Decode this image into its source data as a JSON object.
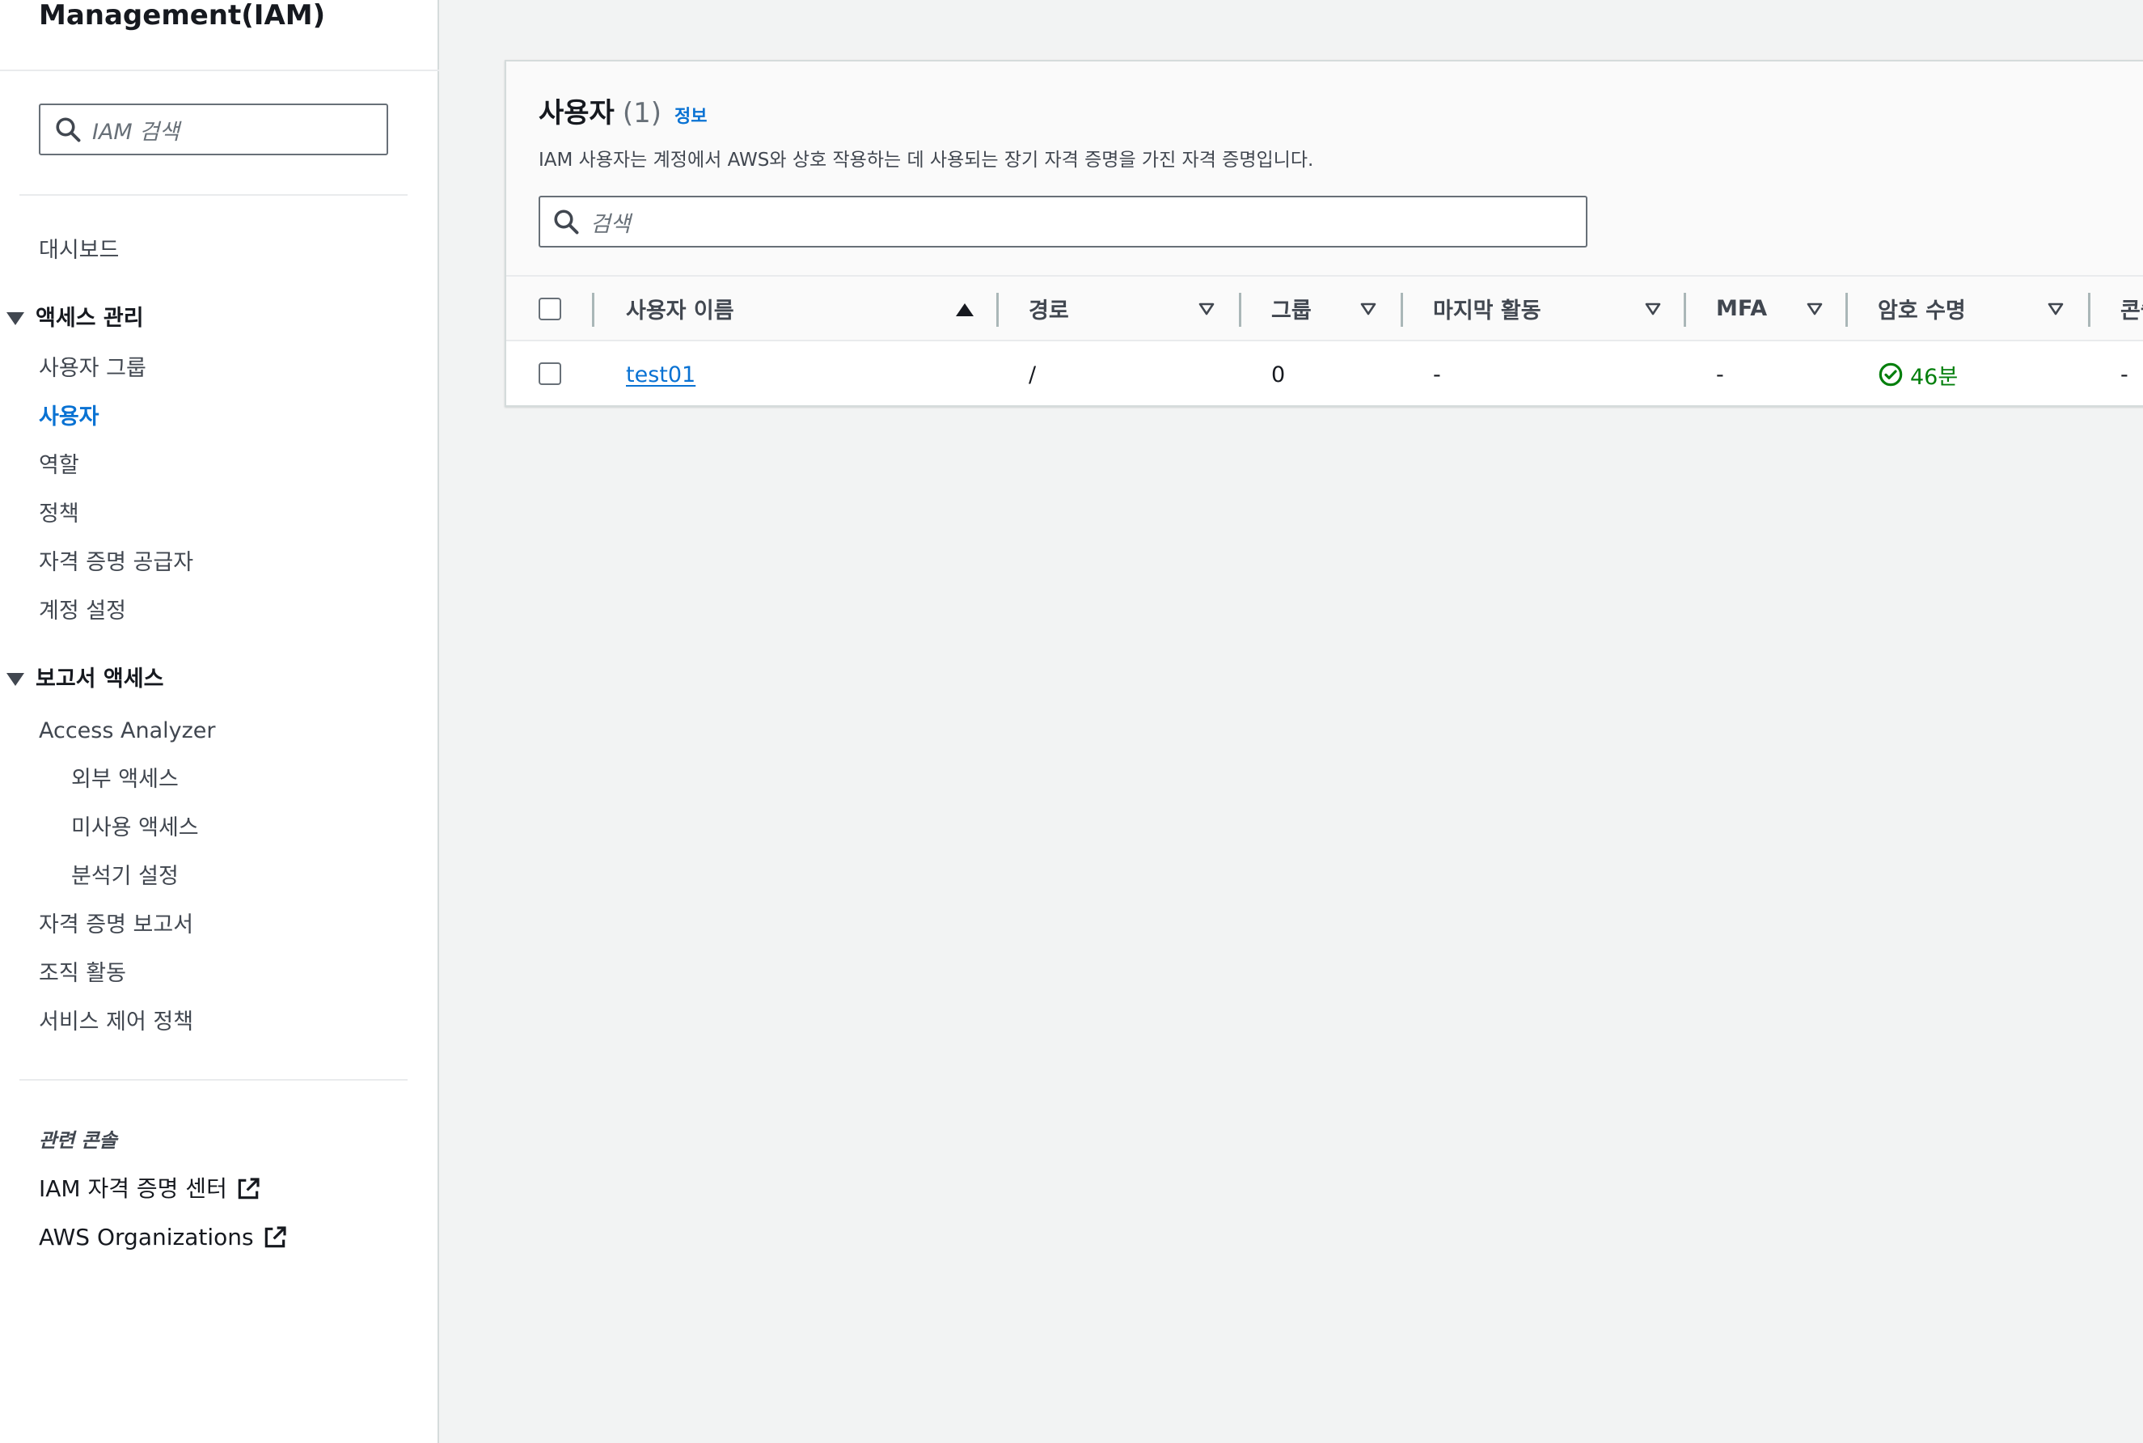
{
  "sidebar": {
    "app_title": "Management(IAM)",
    "search_placeholder": "IAM 검색",
    "dashboard": "대시보드",
    "access_mgmt": {
      "heading": "액세스 관리",
      "items": [
        "사용자 그룹",
        "사용자",
        "역할",
        "정책",
        "자격 증명 공급자",
        "계정 설정"
      ],
      "active": "사용자"
    },
    "report_access": {
      "heading": "보고서 액세스",
      "analyzer": "Access Analyzer",
      "analyzer_sub": [
        "외부 액세스",
        "미사용 액세스",
        "분석기 설정"
      ],
      "items": [
        "자격 증명 보고서",
        "조직 활동",
        "서비스 제어 정책"
      ]
    },
    "related_consoles": {
      "heading": "관련 콘솔",
      "links": [
        "IAM 자격 증명 센터",
        "AWS Organizations"
      ]
    }
  },
  "main": {
    "title": "사용자",
    "count": "(1)",
    "info_link": "정보",
    "description": "IAM 사용자는 계정에서 AWS와 상호 작용하는 데 사용되는 장기 자격 증명을 가진 자격 증명입니다.",
    "search_placeholder": "검색",
    "columns": [
      "사용자 이름",
      "경로",
      "그룹",
      "마지막 활동",
      "MFA",
      "암호 수명",
      "콘솔"
    ],
    "rows": [
      {
        "username": "test01",
        "path": "/",
        "groups": "0",
        "last_activity": "-",
        "mfa": "-",
        "password_age": "46분",
        "console": "-"
      }
    ]
  },
  "colors": {
    "accent": "#0972d3",
    "success": "#037f0c",
    "background": "#f2f3f3"
  },
  "icons": [
    "search-icon",
    "caret-down-icon",
    "external-link-icon",
    "sort-ascending-icon",
    "sort-icon",
    "check-circle-icon"
  ]
}
